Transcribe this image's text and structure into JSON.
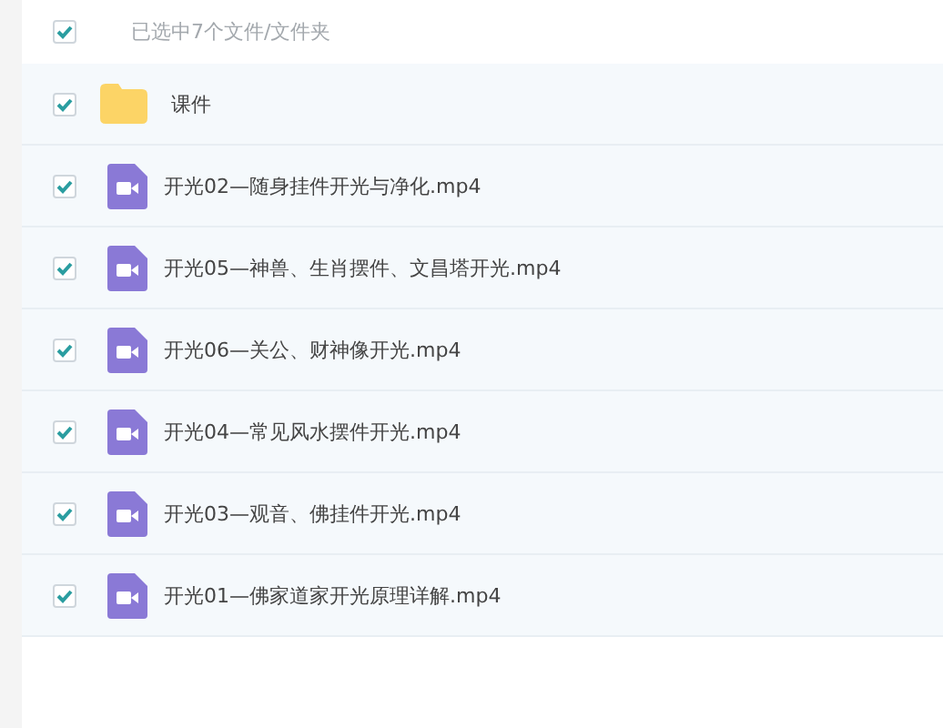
{
  "header": {
    "checked": true,
    "summary": "已选中7个文件/文件夹"
  },
  "files": [
    {
      "kind": "folder",
      "name": "课件",
      "checked": true
    },
    {
      "kind": "video",
      "name": "开光02—随身挂件开光与净化.mp4",
      "checked": true
    },
    {
      "kind": "video",
      "name": "开光05—神兽、生肖摆件、文昌塔开光.mp4",
      "checked": true
    },
    {
      "kind": "video",
      "name": "开光06—关公、财神像开光.mp4",
      "checked": true
    },
    {
      "kind": "video",
      "name": "开光04—常见风水摆件开光.mp4",
      "checked": true
    },
    {
      "kind": "video",
      "name": "开光03—观音、佛挂件开光.mp4",
      "checked": true
    },
    {
      "kind": "video",
      "name": "开光01—佛家道家开光原理详解.mp4",
      "checked": true
    }
  ]
}
